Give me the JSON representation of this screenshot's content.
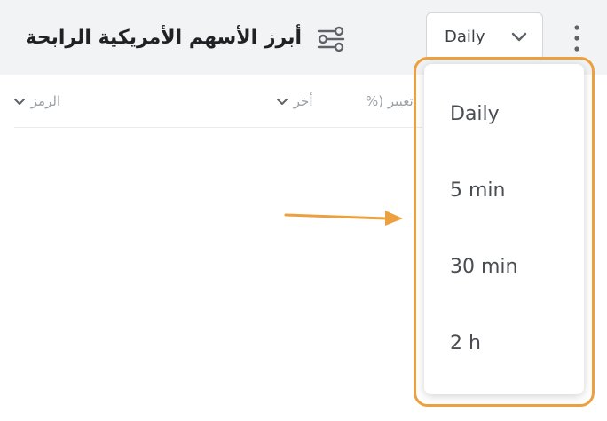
{
  "header": {
    "title": "أبرز الأسهم الأمريكية الرابحة",
    "interval_selected": "Daily",
    "filter_icon": "sliders-icon",
    "more_icon": "more-vertical-icon"
  },
  "columns": [
    {
      "key": "symbol",
      "label": "الرمز"
    },
    {
      "key": "last",
      "label": "أخر"
    },
    {
      "key": "change",
      "label": "تغيير (%"
    }
  ],
  "interval_menu": {
    "options": [
      "Daily",
      "5 min",
      "30 min",
      "2 h"
    ]
  },
  "annotation": {
    "highlight_color": "#eda13e",
    "arrow_color": "#eda13e"
  }
}
